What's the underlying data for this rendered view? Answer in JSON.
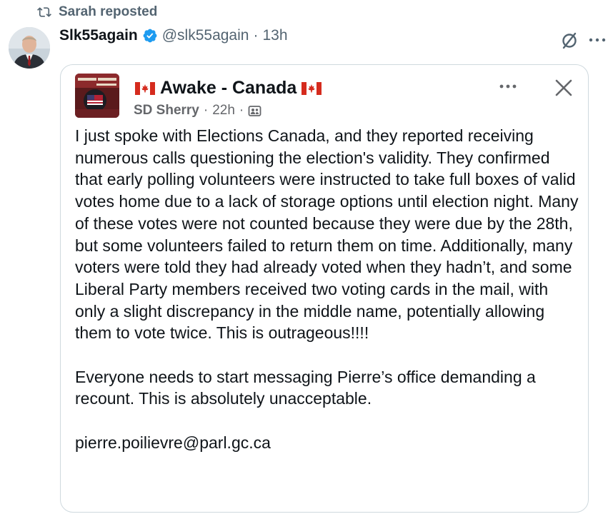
{
  "repost": {
    "label": "Sarah reposted",
    "icon": "repost-icon"
  },
  "author": {
    "name": "Slk55again",
    "verified": true,
    "handle": "@slk55again",
    "separator": "·",
    "time": "13h"
  },
  "actions": {
    "grok_icon": "grok-icon",
    "more_icon": "more-icon"
  },
  "quoted_post": {
    "group_name": "Awake - Canada",
    "poster_name": "SD Sherry",
    "time": "22h",
    "separator": "·",
    "audience_icon": "members-icon",
    "text": "I just spoke with Elections Canada, and they reported receiving numerous calls questioning the election's validity. They confirmed that early polling volunteers were instructed to take full boxes of valid votes home due to a lack of storage options until election night. Many of these votes were not counted because they were due by the 28th, but some volunteers failed to return them on time. Additionally, many voters were told they had already voted when they hadn’t, and some Liberal Party members received two voting cards in the mail, with only a slight discrepancy in the middle name, potentially allowing them to vote twice. This is outrageous!!!!\n\nEveryone needs to start messaging Pierre’s office demanding a recount. This is absolutely unacceptable.\n\npierre.poilievre@parl.gc.ca"
  },
  "colors": {
    "text_primary": "#0f1419",
    "text_secondary": "#536471",
    "verified_blue": "#1d9bf0",
    "canada_red": "#d52b1e",
    "border": "#cfd9de"
  }
}
